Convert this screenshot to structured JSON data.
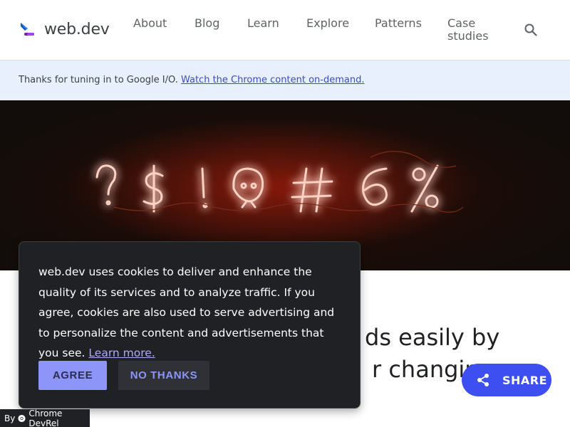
{
  "header": {
    "logo_text": "web.dev",
    "nav": [
      "About",
      "Blog",
      "Learn",
      "Explore",
      "Patterns",
      "Case studies"
    ],
    "search_icon": "search-icon"
  },
  "banner": {
    "text": "Thanks for tuning in to Google I/O. ",
    "link": "Watch the Chrome content on-demand."
  },
  "hero": {
    "image": "neon-symbols",
    "symbols": "?$!☠#6%"
  },
  "article": {
    "title_line_1": "ds easily by",
    "title_line_2": "r changing"
  },
  "cookie_dialog": {
    "text": "web.dev uses cookies to deliver and enhance the quality of its services and to analyze traffic. If you agree, cookies are also used to serve advertising and to personalize the content and advertisements that you see. ",
    "learn_more": "Learn more.",
    "agree_label": "AGREE",
    "no_thanks_label": "NO THANKS"
  },
  "share": {
    "label": "SHARE",
    "icon": "share-icon"
  },
  "badge": {
    "by": "By",
    "name": "Chrome DevRel"
  },
  "colors": {
    "accent": "#3d4ff0",
    "agree_bg": "#8e95f8",
    "dialog_bg": "#202124",
    "banner_bg": "#e8f0fe"
  }
}
